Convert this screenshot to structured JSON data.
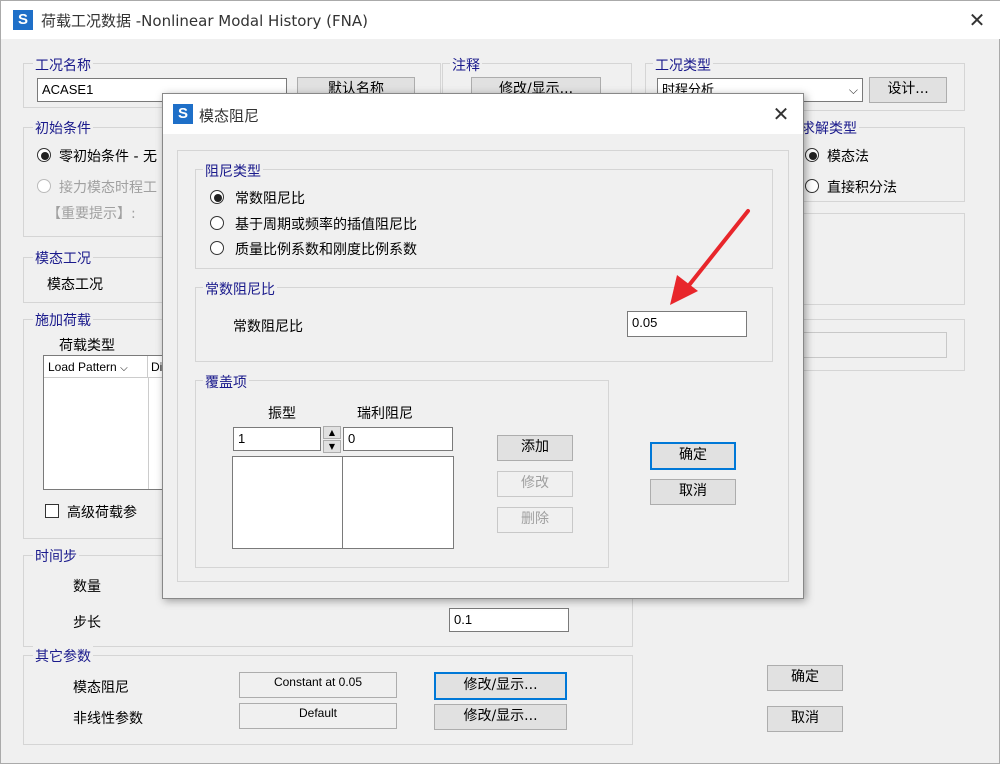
{
  "main": {
    "title": "荷载工况数据 -Nonlinear Modal History (FNA)",
    "case_name_group": "工况名称",
    "case_name_value": "ACASE1",
    "default_name_button": "默认名称",
    "notes_group": "注释",
    "notes_button": "修改/显示...",
    "case_type_group": "工况类型",
    "case_type_value": "时程分析",
    "design_button": "设计...",
    "initial_group": "初始条件",
    "initial_zero": "零初始条件 - 无",
    "initial_continue": "接力模态时程工",
    "important_hint": "【重要提示】:",
    "solve_type_group": "求解类型",
    "solve_modal": "模态法",
    "solve_direct": "直接积分法",
    "modal_case_group": "模态工况",
    "modal_case_label": "模态工况",
    "loads_group": "施加荷载",
    "load_type_label": "荷载类型",
    "load_col_header": "Load Pattern",
    "load_col_header2": "Di",
    "advanced_load": "高级荷载参",
    "timestep_group": "时间步",
    "count_label": "数量",
    "step_label": "步长",
    "step_value": "0.1",
    "other_group": "其它参数",
    "modal_damping_label": "模态阻尼",
    "modal_damping_value": "Constant at 0.05",
    "modal_damping_button": "修改/显示...",
    "nonlinear_label": "非线性参数",
    "nonlinear_value": "Default",
    "nonlinear_button": "修改/显示...",
    "ok_button": "确定",
    "cancel_button": "取消"
  },
  "dialog": {
    "title": "模态阻尼",
    "damping_type_group": "阻尼类型",
    "opt_constant": "常数阻尼比",
    "opt_interp": "基于周期或频率的插值阻尼比",
    "opt_mass_stiff": "质量比例系数和刚度比例系数",
    "constant_group": "常数阻尼比",
    "constant_label": "常数阻尼比",
    "constant_value": "0.05",
    "override_group": "覆盖项",
    "mode_header": "振型",
    "rayleigh_header": "瑞利阻尼",
    "mode_value": "1",
    "rayleigh_value": "0",
    "add_button": "添加",
    "modify_button": "修改",
    "delete_button": "删除",
    "ok_button": "确定",
    "cancel_button": "取消"
  },
  "annotation_color": "#e8262b",
  "icons": [
    "app-logo-icon",
    "close-icon",
    "dropdown-arrow-icon",
    "spin-up-icon",
    "spin-down-icon",
    "red-arrow-icon"
  ]
}
